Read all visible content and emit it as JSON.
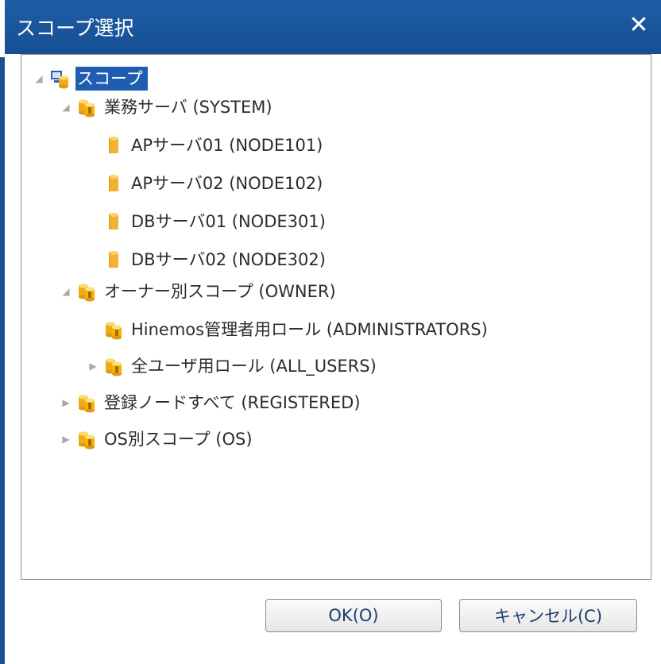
{
  "dialog": {
    "title": "スコープ選択",
    "close_label": "✕"
  },
  "tree": {
    "root": {
      "label": "スコープ",
      "expanded": true,
      "selected": true,
      "icon": "root-scope-icon"
    },
    "items": [
      {
        "label": "業務サーバ (SYSTEM)",
        "expanded": true,
        "icon": "scope-icon"
      },
      {
        "label": "APサーバ01 (NODE101)",
        "icon": "node-icon"
      },
      {
        "label": "APサーバ02 (NODE102)",
        "icon": "node-icon"
      },
      {
        "label": "DBサーバ01 (NODE301)",
        "icon": "node-icon"
      },
      {
        "label": "DBサーバ02 (NODE302)",
        "icon": "node-icon"
      },
      {
        "label": "オーナー別スコープ (OWNER)",
        "expanded": true,
        "icon": "scope-icon"
      },
      {
        "label": "Hinemos管理者用ロール (ADMINISTRATORS)",
        "icon": "scope-icon"
      },
      {
        "label": "全ユーザ用ロール (ALL_USERS)",
        "expanded": false,
        "icon": "scope-icon"
      },
      {
        "label": "登録ノードすべて (REGISTERED)",
        "expanded": false,
        "icon": "scope-icon"
      },
      {
        "label": "OS別スコープ (OS)",
        "expanded": false,
        "icon": "scope-icon"
      }
    ]
  },
  "buttons": {
    "ok": "OK(O)",
    "cancel": "キャンセル(C)"
  },
  "colors": {
    "titlebar": "#1b569c",
    "selection": "#1f5db2",
    "scope_icon": "#f4b400",
    "node_icon": "#f2b233"
  }
}
